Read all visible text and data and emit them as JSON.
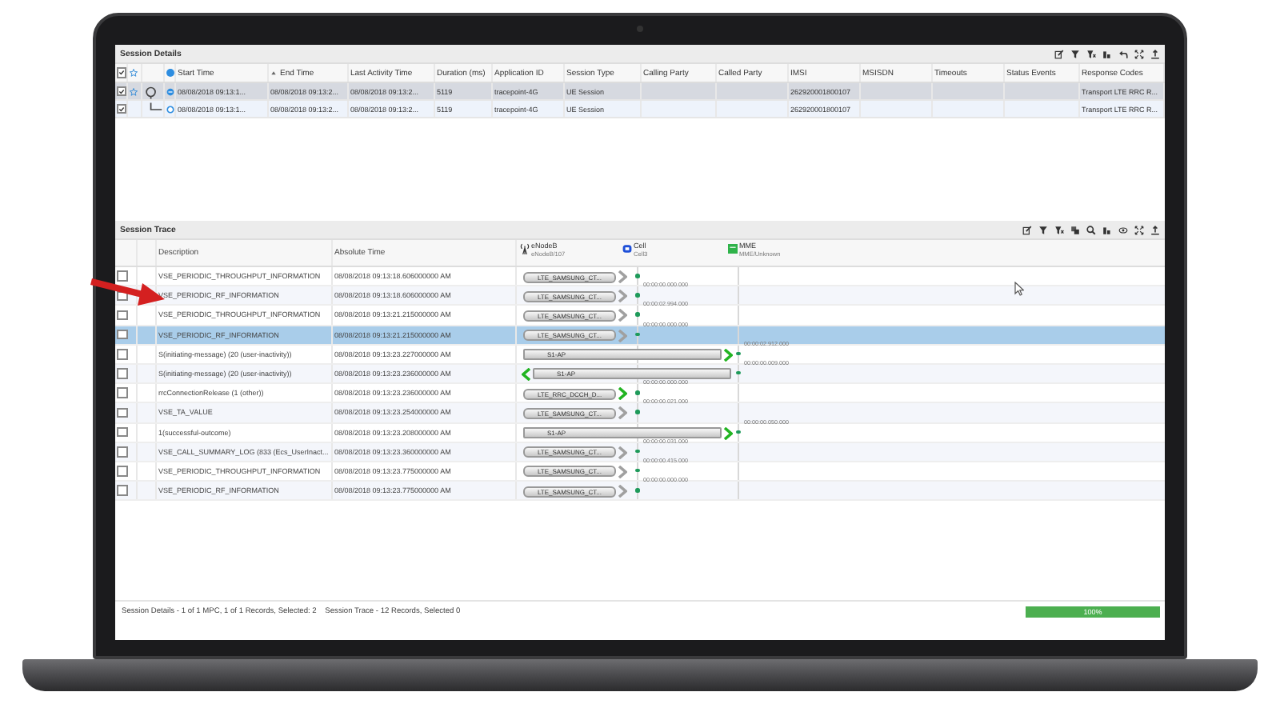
{
  "session_details": {
    "title": "Session Details",
    "header_checked": true,
    "columns": [
      {
        "label": "Start Time",
        "sorted": false
      },
      {
        "label": "End Time",
        "sorted": true
      },
      {
        "label": "Last Activity Time",
        "sorted": false
      },
      {
        "label": "Duration (ms)",
        "sorted": false
      },
      {
        "label": "Application ID",
        "sorted": false
      },
      {
        "label": "Session Type",
        "sorted": false
      },
      {
        "label": "Calling Party",
        "sorted": false
      },
      {
        "label": "Called Party",
        "sorted": false
      },
      {
        "label": "IMSI",
        "sorted": false
      },
      {
        "label": "MSISDN",
        "sorted": false
      },
      {
        "label": "Timeouts",
        "sorted": false
      },
      {
        "label": "Status Events",
        "sorted": false
      },
      {
        "label": "Response Codes",
        "sorted": false
      }
    ],
    "rows": [
      {
        "checked": true,
        "starred": true,
        "selected": true,
        "cells": [
          "08/08/2018 09:13:1...",
          "08/08/2018 09:13:2...",
          "08/08/2018 09:13:2...",
          "5119",
          "tracepoint-4G",
          "UE Session",
          "",
          "",
          "262920001800107",
          "",
          "",
          "",
          "Transport LTE RRC R..."
        ],
        "children": [
          {
            "checked": true,
            "starred": false,
            "selected": false,
            "cells": [
              "08/08/2018 09:13:1...",
              "08/08/2018 09:13:2...",
              "08/08/2018 09:13:2...",
              "5119",
              "tracepoint-4G",
              "UE Session",
              "",
              "",
              "262920001800107",
              "",
              "",
              "",
              "Transport LTE RRC R..."
            ]
          }
        ]
      }
    ]
  },
  "session_trace": {
    "title": "Session Trace",
    "columns": [
      "Description",
      "Absolute Time"
    ],
    "lifelines": [
      {
        "name": "eNodeB",
        "sub": "eNodeB/107"
      },
      {
        "name": "Cell",
        "sub": "Cell3"
      },
      {
        "name": "MME",
        "sub": "MME/Unknown"
      }
    ],
    "rows": [
      {
        "checked": false,
        "selected": false,
        "description": "VSE_PERIODIC_THROUGHPUT_INFORMATION",
        "time": "08/08/2018 09:13:18.606000000 AM",
        "message": {
          "kind": "local",
          "label": "LTE_SAMSUNG_CT...",
          "reversed": false,
          "color": "#a0a0a0"
        },
        "interval": {
          "kind": "cell",
          "text": "00:00:00.000.000"
        }
      },
      {
        "checked": false,
        "selected": false,
        "description": "VSE_PERIODIC_RF_INFORMATION",
        "time": "08/08/2018 09:13:18.606000000 AM",
        "message": {
          "kind": "local",
          "label": "LTE_SAMSUNG_CT...",
          "reversed": false,
          "color": "#a0a0a0"
        },
        "interval": {
          "kind": "cell",
          "text": "00:00:02.994.000"
        }
      },
      {
        "checked": false,
        "selected": false,
        "description": "VSE_PERIODIC_THROUGHPUT_INFORMATION",
        "time": "08/08/2018 09:13:21.215000000 AM",
        "message": {
          "kind": "local",
          "label": "LTE_SAMSUNG_CT...",
          "reversed": false,
          "color": "#a0a0a0"
        },
        "interval": {
          "kind": "cell",
          "text": "00:00:00.000.000"
        }
      },
      {
        "checked": false,
        "selected": true,
        "description": "VSE_PERIODIC_RF_INFORMATION",
        "time": "08/08/2018 09:13:21.215000000 AM",
        "message": {
          "kind": "local",
          "label": "LTE_SAMSUNG_CT...",
          "reversed": false,
          "color": "#a0a0a0"
        },
        "interval": {
          "kind": "mme",
          "text": "00:00:02.912.000"
        }
      },
      {
        "checked": false,
        "selected": false,
        "description": "S(initiating-message) (20 (user-inactivity))",
        "time": "08/08/2018 09:13:23.227000000 AM",
        "message": {
          "kind": "s1",
          "label": "S1-AP",
          "reversed": false,
          "color": "#22b422"
        },
        "interval": {
          "kind": "mme",
          "text": "00:00:00.009.000"
        }
      },
      {
        "checked": false,
        "selected": false,
        "description": "S(initiating-message) (20 (user-inactivity))",
        "time": "08/08/2018 09:13:23.236000000 AM",
        "message": {
          "kind": "s1",
          "label": "S1-AP",
          "reversed": true,
          "color": "#22b422"
        },
        "interval": {
          "kind": "cell",
          "text": "00:00:00.000.000"
        }
      },
      {
        "checked": false,
        "selected": false,
        "description": "rrcConnectionRelease (1 (other))",
        "time": "08/08/2018 09:13:23.236000000 AM",
        "message": {
          "kind": "local",
          "label": "LTE_RRC_DCCH_D...",
          "reversed": false,
          "color": "#22b422"
        },
        "interval": {
          "kind": "cell",
          "text": "00:00:00.021.000"
        }
      },
      {
        "checked": false,
        "selected": false,
        "description": "VSE_TA_VALUE",
        "time": "08/08/2018 09:13:23.254000000 AM",
        "message": {
          "kind": "local",
          "label": "LTE_SAMSUNG_CT...",
          "reversed": false,
          "color": "#a0a0a0"
        },
        "interval": {
          "kind": "mme",
          "text": "00:00:00.050.000"
        }
      },
      {
        "checked": false,
        "selected": false,
        "description": "1(successful-outcome)",
        "time": "08/08/2018 09:13:23.208000000 AM",
        "message": {
          "kind": "s1",
          "label": "S1-AP",
          "reversed": false,
          "color": "#22b422"
        },
        "interval": {
          "kind": "cell",
          "text": "00:00:00.031.000"
        }
      },
      {
        "checked": false,
        "selected": false,
        "description": "VSE_CALL_SUMMARY_LOG (833 (Ecs_UserInact...",
        "time": "08/08/2018 09:13:23.360000000 AM",
        "message": {
          "kind": "local",
          "label": "LTE_SAMSUNG_CT...",
          "reversed": false,
          "color": "#a0a0a0"
        },
        "interval": {
          "kind": "cell",
          "text": "00:00:00.415.000"
        }
      },
      {
        "checked": false,
        "selected": false,
        "description": "VSE_PERIODIC_THROUGHPUT_INFORMATION",
        "time": "08/08/2018 09:13:23.775000000 AM",
        "message": {
          "kind": "local",
          "label": "LTE_SAMSUNG_CT...",
          "reversed": false,
          "color": "#a0a0a0"
        },
        "interval": {
          "kind": "cell",
          "text": "00:00:00.000.000"
        }
      },
      {
        "checked": false,
        "selected": false,
        "description": "VSE_PERIODIC_RF_INFORMATION",
        "time": "08/08/2018 09:13:23.775000000 AM",
        "message": {
          "kind": "local",
          "label": "LTE_SAMSUNG_CT...",
          "reversed": false,
          "color": "#a0a0a0"
        }
      }
    ]
  },
  "status_bar": {
    "text": "Session Details - 1 of 1 MPC, 1 of 1 Records, Selected: 2    Session Trace - 12 Records, Selected 0",
    "progress": {
      "level": 1,
      "label": "100%"
    }
  }
}
